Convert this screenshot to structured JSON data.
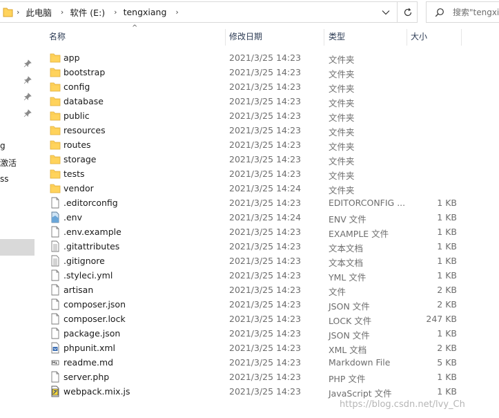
{
  "address": {
    "crumbs": [
      "此电脑",
      "软件 (E:)",
      "tengxiang"
    ]
  },
  "search": {
    "placeholder": "搜索\"tengxi"
  },
  "nav": {
    "items": [
      {
        "label": "g"
      },
      {
        "label": "激活"
      },
      {
        "label": "ss"
      }
    ]
  },
  "columns": {
    "name": "名称",
    "date": "修改日期",
    "type": "类型",
    "size": "大小"
  },
  "files": [
    {
      "name": "app",
      "date": "2021/3/25 14:23",
      "type": "文件夹",
      "size": "",
      "icon": "folder-icon"
    },
    {
      "name": "bootstrap",
      "date": "2021/3/25 14:23",
      "type": "文件夹",
      "size": "",
      "icon": "folder-icon"
    },
    {
      "name": "config",
      "date": "2021/3/25 14:23",
      "type": "文件夹",
      "size": "",
      "icon": "folder-icon"
    },
    {
      "name": "database",
      "date": "2021/3/25 14:23",
      "type": "文件夹",
      "size": "",
      "icon": "folder-icon"
    },
    {
      "name": "public",
      "date": "2021/3/25 14:23",
      "type": "文件夹",
      "size": "",
      "icon": "folder-icon"
    },
    {
      "name": "resources",
      "date": "2021/3/25 14:23",
      "type": "文件夹",
      "size": "",
      "icon": "folder-icon"
    },
    {
      "name": "routes",
      "date": "2021/3/25 14:23",
      "type": "文件夹",
      "size": "",
      "icon": "folder-icon"
    },
    {
      "name": "storage",
      "date": "2021/3/25 14:23",
      "type": "文件夹",
      "size": "",
      "icon": "folder-icon"
    },
    {
      "name": "tests",
      "date": "2021/3/25 14:23",
      "type": "文件夹",
      "size": "",
      "icon": "folder-icon"
    },
    {
      "name": "vendor",
      "date": "2021/3/25 14:24",
      "type": "文件夹",
      "size": "",
      "icon": "folder-icon"
    },
    {
      "name": ".editorconfig",
      "date": "2021/3/25 14:23",
      "type": "EDITORCONFIG ...",
      "size": "1 KB",
      "icon": "blank-file-icon"
    },
    {
      "name": ".env",
      "date": "2021/3/25 14:24",
      "type": "ENV 文件",
      "size": "1 KB",
      "icon": "env-file-icon"
    },
    {
      "name": ".env.example",
      "date": "2021/3/25 14:23",
      "type": "EXAMPLE 文件",
      "size": "1 KB",
      "icon": "blank-file-icon"
    },
    {
      "name": ".gitattributes",
      "date": "2021/3/25 14:23",
      "type": "文本文档",
      "size": "1 KB",
      "icon": "text-file-icon"
    },
    {
      "name": ".gitignore",
      "date": "2021/3/25 14:23",
      "type": "文本文档",
      "size": "1 KB",
      "icon": "text-file-icon"
    },
    {
      "name": ".styleci.yml",
      "date": "2021/3/25 14:23",
      "type": "YML 文件",
      "size": "1 KB",
      "icon": "blank-file-icon"
    },
    {
      "name": "artisan",
      "date": "2021/3/25 14:23",
      "type": "文件",
      "size": "2 KB",
      "icon": "blank-file-icon"
    },
    {
      "name": "composer.json",
      "date": "2021/3/25 14:23",
      "type": "JSON 文件",
      "size": "2 KB",
      "icon": "blank-file-icon"
    },
    {
      "name": "composer.lock",
      "date": "2021/3/25 14:23",
      "type": "LOCK 文件",
      "size": "247 KB",
      "icon": "blank-file-icon"
    },
    {
      "name": "package.json",
      "date": "2021/3/25 14:23",
      "type": "JSON 文件",
      "size": "1 KB",
      "icon": "blank-file-icon"
    },
    {
      "name": "phpunit.xml",
      "date": "2021/3/25 14:23",
      "type": "XML 文档",
      "size": "2 KB",
      "icon": "xml-file-icon"
    },
    {
      "name": "readme.md",
      "date": "2021/3/25 14:23",
      "type": "Markdown File",
      "size": "5 KB",
      "icon": "markdown-file-icon"
    },
    {
      "name": "server.php",
      "date": "2021/3/25 14:23",
      "type": "PHP 文件",
      "size": "1 KB",
      "icon": "blank-file-icon"
    },
    {
      "name": "webpack.mix.js",
      "date": "2021/3/25 14:23",
      "type": "JavaScript 文件",
      "size": "1 KB",
      "icon": "js-file-icon"
    }
  ],
  "watermark": "https://blog.csdn.net/lvy_Ch",
  "colors": {
    "folder": "#ffd35c",
    "folder_dark": "#e7b23a",
    "muted_text": "#6d6d6d",
    "header_text": "#2b3a53"
  }
}
